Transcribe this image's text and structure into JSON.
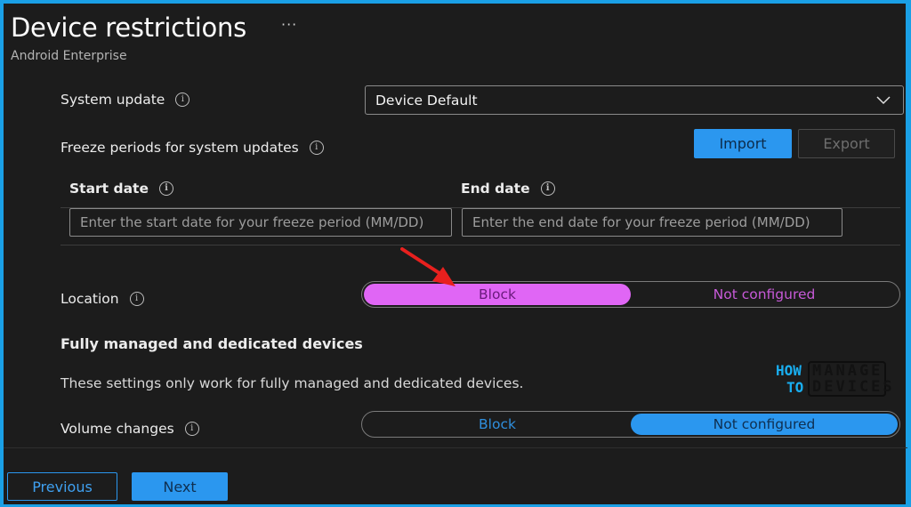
{
  "header": {
    "title": "Device restrictions",
    "more_label": "···",
    "subtitle": "Android Enterprise"
  },
  "system_update": {
    "label": "System update",
    "selected_value": "Device Default"
  },
  "freeze_periods": {
    "label": "Freeze periods for system updates",
    "import_label": "Import",
    "export_label": "Export",
    "start_date": {
      "label": "Start date",
      "placeholder": "Enter the start date for your freeze period (MM/DD)",
      "value": ""
    },
    "end_date": {
      "label": "End date",
      "placeholder": "Enter the end date for your freeze period (MM/DD)",
      "value": ""
    }
  },
  "location": {
    "label": "Location",
    "options": [
      "Block",
      "Not configured"
    ],
    "selected": "Block"
  },
  "fully_managed": {
    "heading": "Fully managed and dedicated devices",
    "description": "These settings only work for fully managed and dedicated devices."
  },
  "volume_changes": {
    "label": "Volume changes",
    "options": [
      "Block",
      "Not configured"
    ],
    "selected": "Not configured"
  },
  "footer": {
    "previous_label": "Previous",
    "next_label": "Next"
  },
  "watermark": {
    "line1a": "HOW",
    "line1b": "MANAGE",
    "line2a": "TO",
    "line2b": "DEVICES"
  },
  "colors": {
    "accent_blue": "#2b97ef",
    "location_block_highlight": "#e066f5",
    "annotation_arrow": "#e8201e",
    "frame_border": "#1aa0e6"
  }
}
